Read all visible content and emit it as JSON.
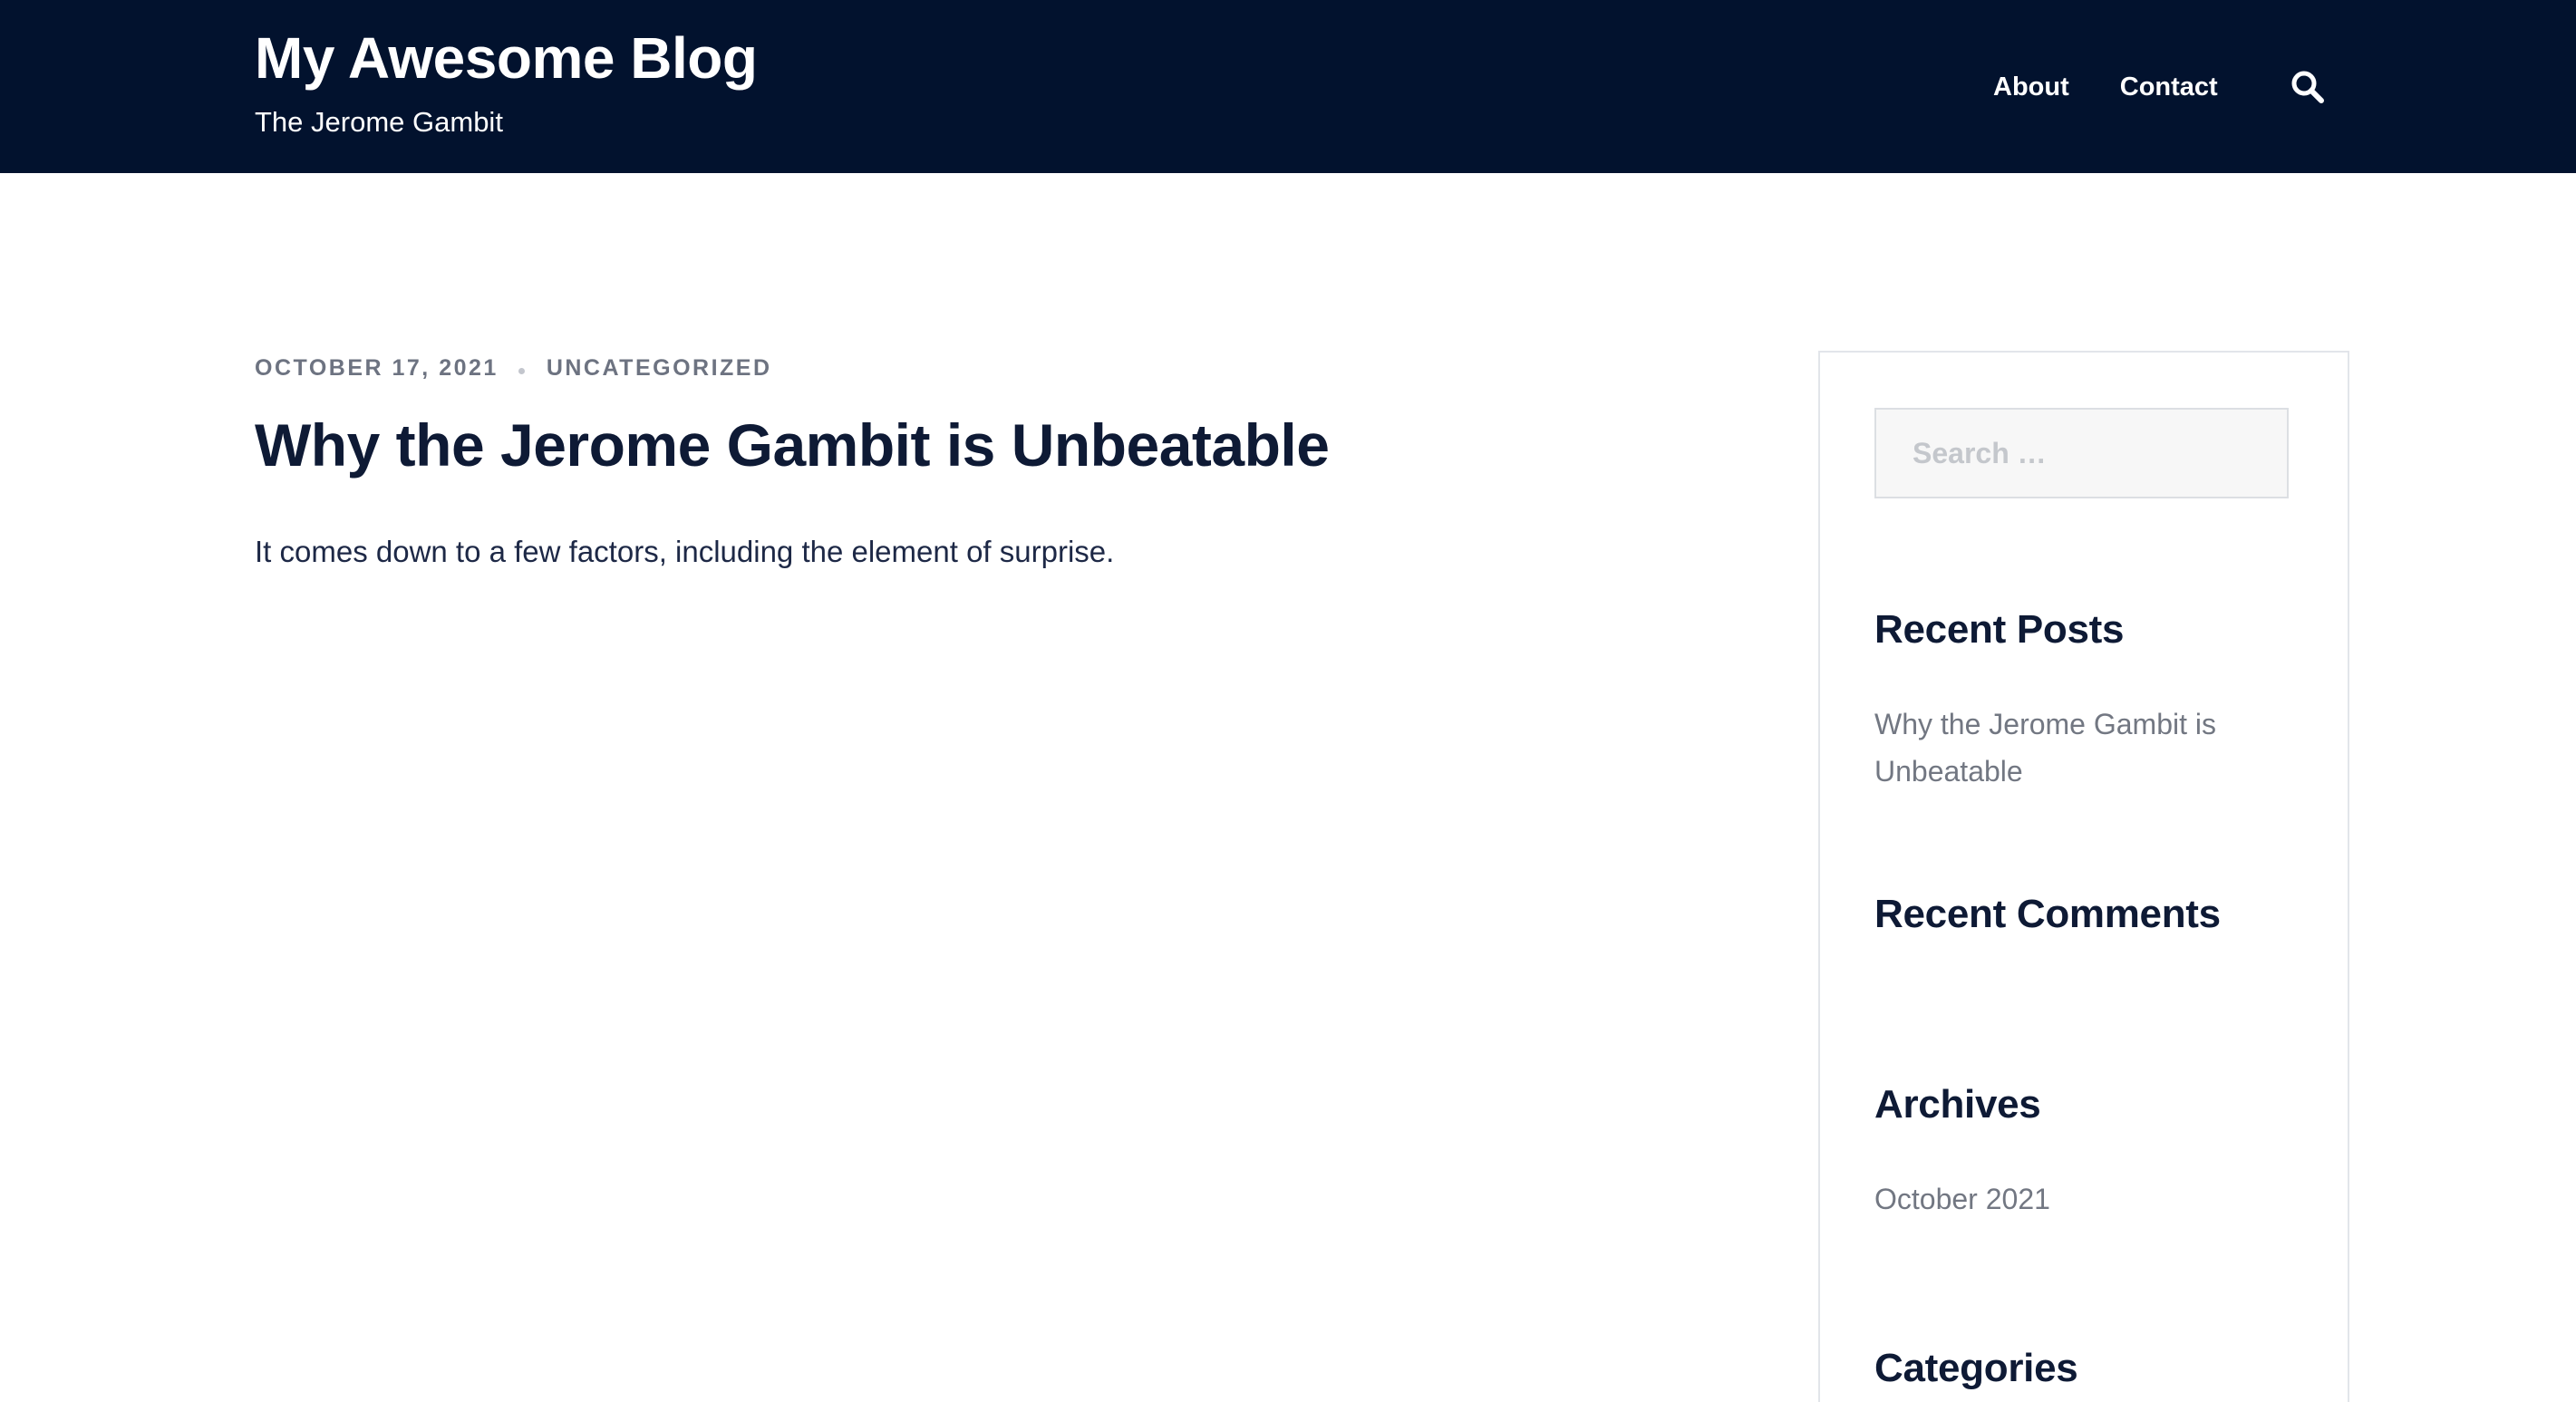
{
  "header": {
    "site_title": "My Awesome Blog",
    "tagline": "The Jerome Gambit",
    "nav": [
      {
        "label": "About"
      },
      {
        "label": "Contact"
      }
    ],
    "search_icon": "search-icon",
    "background_color": "#02122e"
  },
  "post": {
    "date": "OCTOBER 17, 2021",
    "category": "UNCATEGORIZED",
    "title": "Why the Jerome Gambit is Unbeatable",
    "excerpt": "It comes down to a few factors, including the element of surprise."
  },
  "sidebar": {
    "search_placeholder": "Search …",
    "recent_posts": {
      "title": "Recent Posts",
      "items": [
        "Why the Jerome Gambit is Unbeatable"
      ]
    },
    "recent_comments": {
      "title": "Recent Comments"
    },
    "archives": {
      "title": "Archives",
      "items": [
        "October 2021"
      ]
    },
    "categories": {
      "title": "Categories"
    }
  }
}
